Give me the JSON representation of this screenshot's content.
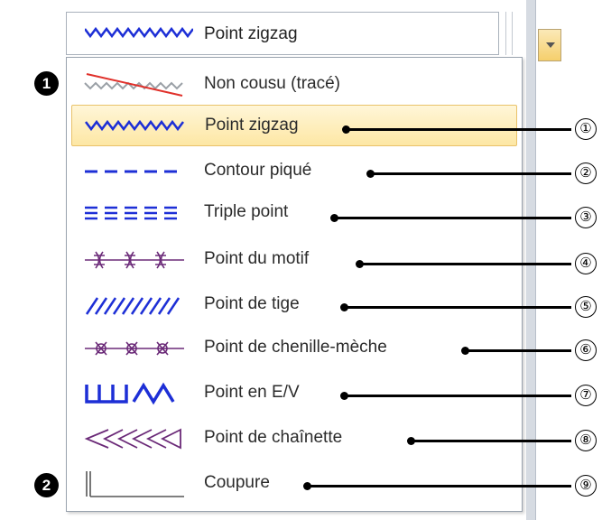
{
  "combo": {
    "selected_label": "Point zigzag",
    "sample_icon": "zigzag-stitch-icon"
  },
  "items": [
    {
      "label": "Non cousu (tracé)",
      "icon": "not-sewn-stitch-icon",
      "callout": ""
    },
    {
      "label": "Point zigzag",
      "icon": "zigzag-stitch-icon",
      "callout": "①",
      "selected": true
    },
    {
      "label": "Contour piqué",
      "icon": "running-stitch-icon",
      "callout": "②"
    },
    {
      "label": "Triple point",
      "icon": "triple-stitch-icon",
      "callout": "③"
    },
    {
      "label": "Point du motif",
      "icon": "motif-stitch-icon",
      "callout": "④"
    },
    {
      "label": "Point de tige",
      "icon": "stem-stitch-icon",
      "callout": "⑤"
    },
    {
      "label": "Point de chenille-mèche",
      "icon": "candlewicking-stitch-icon",
      "callout": "⑥"
    },
    {
      "label": "Point en E/V",
      "icon": "e-v-stitch-icon",
      "callout": "⑦"
    },
    {
      "label": "Point de chaînette",
      "icon": "chain-stitch-icon",
      "callout": "⑧"
    },
    {
      "label": "Coupure",
      "icon": "cut-stitch-icon",
      "callout": "⑨"
    }
  ],
  "badges": {
    "first": "1",
    "second": "2"
  },
  "colors": {
    "stitch_blue": "#1d2fd6",
    "motif_purple": "#6b2a78",
    "selection": "#fde7a4"
  }
}
